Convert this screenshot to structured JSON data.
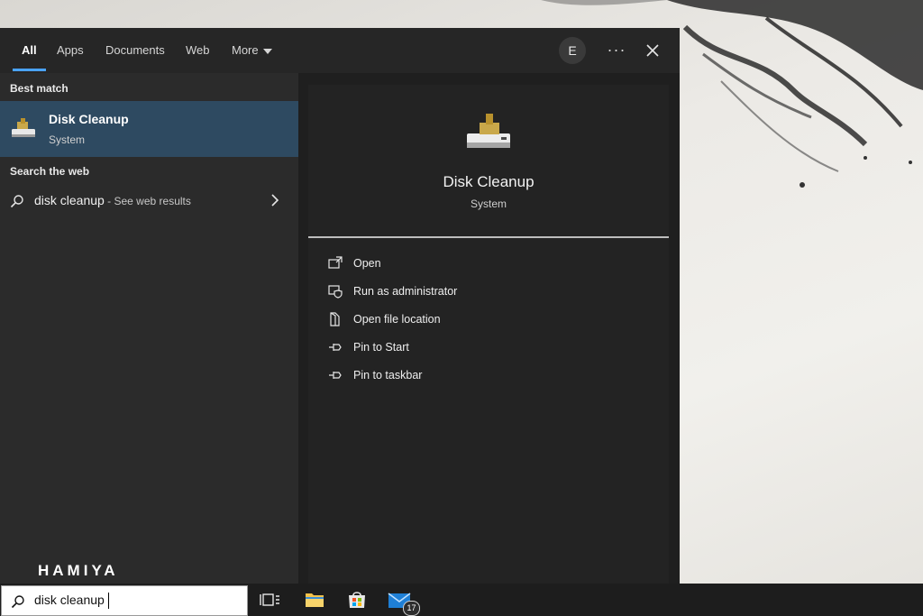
{
  "tabs": [
    "All",
    "Apps",
    "Documents",
    "Web",
    "More"
  ],
  "account_initial": "E",
  "more_options": "···",
  "left": {
    "best_match_label": "Best match",
    "best_match": {
      "title": "Disk Cleanup",
      "subtitle": "System"
    },
    "search_web_label": "Search the web",
    "web_query": "disk cleanup",
    "web_suffix": " - See web results"
  },
  "detail": {
    "title": "Disk Cleanup",
    "subtitle": "System",
    "actions": [
      "Open",
      "Run as administrator",
      "Open file location",
      "Pin to Start",
      "Pin to taskbar"
    ]
  },
  "taskbar": {
    "search_value": "disk cleanup",
    "mail_badge": "17"
  },
  "watermark": "HAMIYA",
  "colors": {
    "accent": "#4aa3ff",
    "selected_row": "#2e4a61"
  }
}
